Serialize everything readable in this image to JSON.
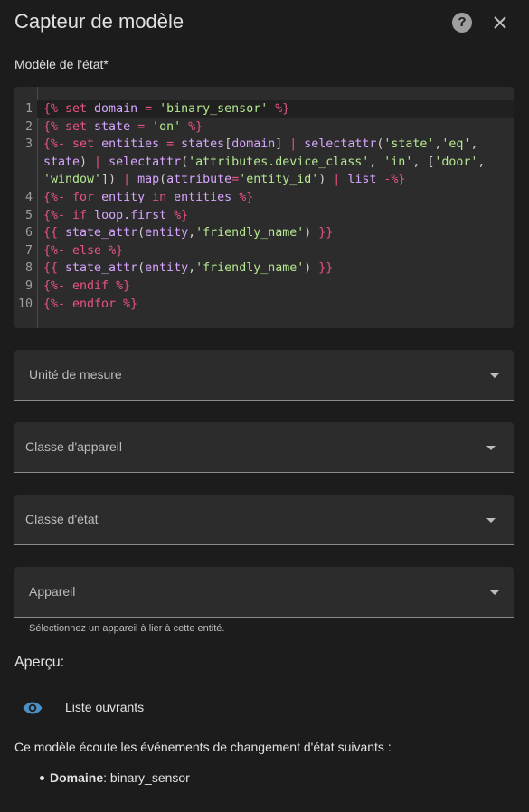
{
  "dialog": {
    "title": "Capteur de modèle",
    "help_icon": "help-circle-icon",
    "close_icon": "close-icon"
  },
  "state_template": {
    "label": "Modèle de l'état*",
    "lines": [
      {
        "num": "1",
        "tokens": [
          {
            "t": "{%",
            "c": "kw"
          },
          {
            "t": " set ",
            "c": "kw"
          },
          {
            "t": "domain",
            "c": "var"
          },
          {
            "t": " = ",
            "c": "kw"
          },
          {
            "t": "'binary_sensor'",
            "c": "str"
          },
          {
            "t": " %}",
            "c": "kw"
          }
        ]
      },
      {
        "num": "2",
        "tokens": [
          {
            "t": "{%",
            "c": "kw"
          },
          {
            "t": " set ",
            "c": "kw"
          },
          {
            "t": "state",
            "c": "var"
          },
          {
            "t": " = ",
            "c": "kw"
          },
          {
            "t": "'on'",
            "c": "str"
          },
          {
            "t": " %}",
            "c": "kw"
          }
        ]
      },
      {
        "num": "3",
        "tokens": [
          {
            "t": "{%-",
            "c": "kw"
          },
          {
            "t": " set ",
            "c": "kw"
          },
          {
            "t": "entities",
            "c": "var"
          },
          {
            "t": " = ",
            "c": "kw"
          },
          {
            "t": "states",
            "c": "var"
          },
          {
            "t": "[",
            "c": "plain"
          },
          {
            "t": "domain",
            "c": "var"
          },
          {
            "t": "] ",
            "c": "plain"
          },
          {
            "t": "| ",
            "c": "kw"
          },
          {
            "t": "selectattr",
            "c": "var"
          },
          {
            "t": "(",
            "c": "plain"
          },
          {
            "t": "'state'",
            "c": "str"
          },
          {
            "t": ",",
            "c": "plain"
          },
          {
            "t": "'eq'",
            "c": "str"
          },
          {
            "t": ",",
            "c": "plain"
          }
        ]
      },
      {
        "num": "",
        "tokens": [
          {
            "t": "state",
            "c": "var"
          },
          {
            "t": ") ",
            "c": "plain"
          },
          {
            "t": "| ",
            "c": "kw"
          },
          {
            "t": "selectattr",
            "c": "var"
          },
          {
            "t": "(",
            "c": "plain"
          },
          {
            "t": "'attributes.device_class'",
            "c": "str"
          },
          {
            "t": ", ",
            "c": "plain"
          },
          {
            "t": "'in'",
            "c": "str"
          },
          {
            "t": ", [",
            "c": "plain"
          },
          {
            "t": "'door'",
            "c": "str"
          },
          {
            "t": ",",
            "c": "plain"
          }
        ]
      },
      {
        "num": "",
        "tokens": [
          {
            "t": "'window'",
            "c": "str"
          },
          {
            "t": "]) ",
            "c": "plain"
          },
          {
            "t": "| ",
            "c": "kw"
          },
          {
            "t": "map",
            "c": "var"
          },
          {
            "t": "(",
            "c": "plain"
          },
          {
            "t": "attribute",
            "c": "var"
          },
          {
            "t": "=",
            "c": "kw"
          },
          {
            "t": "'entity_id'",
            "c": "str"
          },
          {
            "t": ") ",
            "c": "plain"
          },
          {
            "t": "| ",
            "c": "kw"
          },
          {
            "t": "list",
            "c": "var"
          },
          {
            "t": " -%}",
            "c": "kw"
          }
        ]
      },
      {
        "num": "4",
        "tokens": [
          {
            "t": "{%-",
            "c": "kw"
          },
          {
            "t": " for ",
            "c": "kw"
          },
          {
            "t": "entity",
            "c": "var"
          },
          {
            "t": " in ",
            "c": "kw"
          },
          {
            "t": "entities",
            "c": "var"
          },
          {
            "t": " %}",
            "c": "kw"
          }
        ]
      },
      {
        "num": "5",
        "tokens": [
          {
            "t": "{%-",
            "c": "kw"
          },
          {
            "t": " if ",
            "c": "kw"
          },
          {
            "t": "loop.first",
            "c": "var"
          },
          {
            "t": " %}",
            "c": "kw"
          }
        ]
      },
      {
        "num": "6",
        "tokens": [
          {
            "t": "{{",
            "c": "kw"
          },
          {
            "t": " state_attr",
            "c": "var"
          },
          {
            "t": "(",
            "c": "plain"
          },
          {
            "t": "entity",
            "c": "var"
          },
          {
            "t": ",",
            "c": "plain"
          },
          {
            "t": "'friendly_name'",
            "c": "str"
          },
          {
            "t": ") ",
            "c": "plain"
          },
          {
            "t": "}}",
            "c": "kw"
          }
        ]
      },
      {
        "num": "7",
        "tokens": [
          {
            "t": "{%-",
            "c": "kw"
          },
          {
            "t": " else ",
            "c": "kw"
          },
          {
            "t": "%}",
            "c": "kw"
          }
        ]
      },
      {
        "num": "8",
        "tokens": [
          {
            "t": "{{",
            "c": "kw"
          },
          {
            "t": " state_attr",
            "c": "var"
          },
          {
            "t": "(",
            "c": "plain"
          },
          {
            "t": "entity",
            "c": "var"
          },
          {
            "t": ",",
            "c": "plain"
          },
          {
            "t": "'friendly_name'",
            "c": "str"
          },
          {
            "t": ") ",
            "c": "plain"
          },
          {
            "t": "}}",
            "c": "kw"
          }
        ]
      },
      {
        "num": "9",
        "tokens": [
          {
            "t": "{%-",
            "c": "kw"
          },
          {
            "t": " endif ",
            "c": "kw"
          },
          {
            "t": "%}",
            "c": "kw"
          }
        ]
      },
      {
        "num": "10",
        "tokens": [
          {
            "t": "{%-",
            "c": "kw"
          },
          {
            "t": " endfor ",
            "c": "kw"
          },
          {
            "t": "%}",
            "c": "kw"
          }
        ]
      }
    ]
  },
  "fields": [
    {
      "name": "unit-of-measurement-select",
      "label": "Unité de mesure",
      "inset": "wide"
    },
    {
      "name": "device-class-select",
      "label": "Classe d'appareil",
      "inset": "narrow"
    },
    {
      "name": "state-class-select",
      "label": "Classe d'état",
      "inset": "narrow"
    },
    {
      "name": "device-select",
      "label": "Appareil",
      "inset": "wide"
    }
  ],
  "device_helper": "Sélectionnez un appareil à lier à cette entité.",
  "preview": {
    "title": "Aperçu:",
    "entity_icon": "eye-icon",
    "entity_name": "Liste ouvrants",
    "listen_text": "Ce modèle écoute les événements de changement d'état suivants :",
    "listeners": [
      {
        "key": "Domaine",
        "value": ": binary_sensor"
      }
    ]
  },
  "colors": {
    "background": "#1c1c1c",
    "surface": "#2c2c2c",
    "keyword": "#e75480",
    "variable": "#d7a6ff",
    "string": "#b5e890",
    "icon_accent": "#4a90c2"
  }
}
